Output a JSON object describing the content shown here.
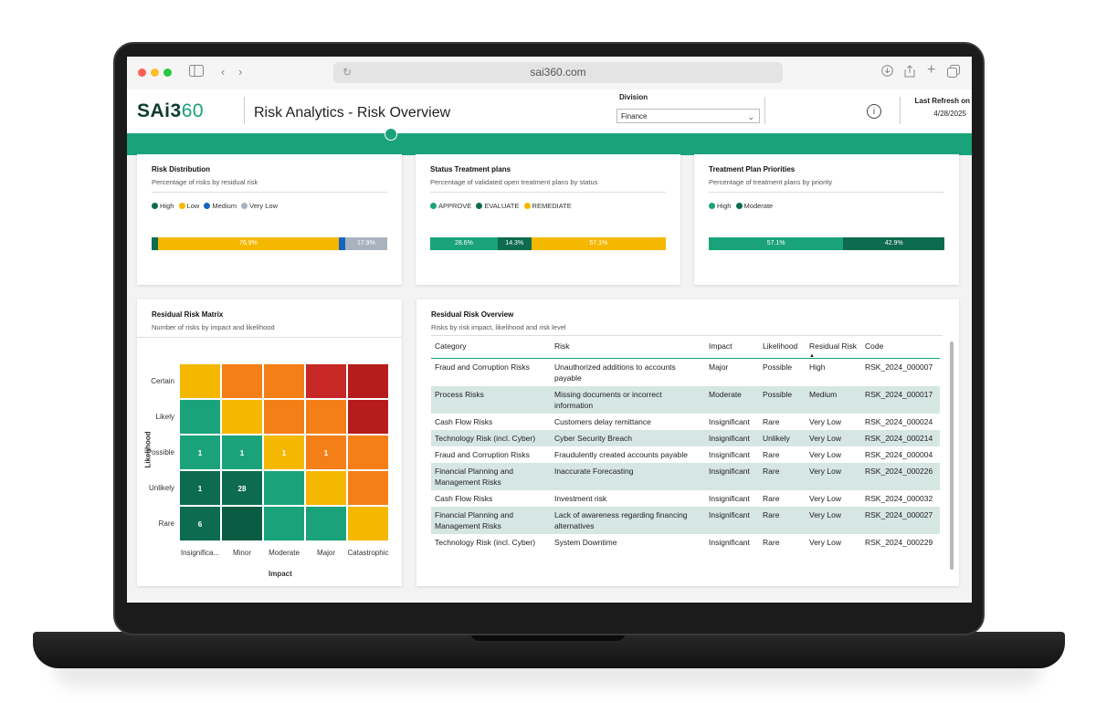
{
  "browser": {
    "url": "sai360.com"
  },
  "header": {
    "logo_main": "SAi3",
    "logo_num": "60",
    "title": "Risk Analytics - Risk Overview",
    "division_label": "Division",
    "division_value": "Finance",
    "refresh_label": "Last Refresh on",
    "refresh_date": "4/28/2025"
  },
  "colors": {
    "brand_green": "#1aa37a",
    "dark_green": "#0d6b4f",
    "amber": "#f5b800",
    "blue": "#1565c0",
    "gray": "#a9b3bf"
  },
  "risk_distribution": {
    "title": "Risk Distribution",
    "subtitle": "Percentage of risks by residual risk",
    "legend": [
      "High",
      "Low",
      "Medium",
      "Very Low"
    ],
    "bar": [
      {
        "name": "High",
        "value": 2.6,
        "label": "",
        "color": "#0d6b4f"
      },
      {
        "name": "Low",
        "value": 76.9,
        "label": "76.9%",
        "color": "#f5b800"
      },
      {
        "name": "Medium",
        "value": 2.6,
        "label": "",
        "color": "#1565c0"
      },
      {
        "name": "Very Low",
        "value": 17.9,
        "label": "17.9%",
        "color": "#a9b3bf"
      }
    ]
  },
  "status_treatment": {
    "title": "Status Treatment plans",
    "subtitle": "Percentage of validated open treatment plans by status",
    "legend": [
      "APPROVE",
      "EVALUATE",
      "REMEDIATE"
    ],
    "bar": [
      {
        "name": "APPROVE",
        "value": 28.6,
        "label": "28.6%",
        "color": "#1aa37a"
      },
      {
        "name": "EVALUATE",
        "value": 14.3,
        "label": "14.3%",
        "color": "#0d6b4f"
      },
      {
        "name": "REMEDIATE",
        "value": 57.1,
        "label": "57.1%",
        "color": "#f5b800"
      }
    ]
  },
  "treatment_priorities": {
    "title": "Treatment Plan Priorities",
    "subtitle": "Percentage of treatment plans by priority",
    "legend": [
      "High",
      "Moderate"
    ],
    "bar": [
      {
        "name": "High",
        "value": 57.1,
        "label": "57.1%",
        "color": "#1aa37a"
      },
      {
        "name": "Moderate",
        "value": 42.9,
        "label": "42.9%",
        "color": "#0d6b4f"
      }
    ]
  },
  "matrix": {
    "title": "Residual Risk Matrix",
    "subtitle": "Number of risks by impact and likelihood",
    "y_title": "Likelihood",
    "x_title": "Impact",
    "y_labels": [
      "Certain",
      "Likely",
      "Possible",
      "Unlikely",
      "Rare"
    ],
    "x_labels": [
      "Insignifica...",
      "Minor",
      "Moderate",
      "Major",
      "Catastrophic"
    ],
    "cells": [
      [
        {
          "c": "#f5b800",
          "v": ""
        },
        {
          "c": "#f57f17",
          "v": ""
        },
        {
          "c": "#f57f17",
          "v": ""
        },
        {
          "c": "#c62828",
          "v": ""
        },
        {
          "c": "#b71c1c",
          "v": ""
        }
      ],
      [
        {
          "c": "#1aa37a",
          "v": ""
        },
        {
          "c": "#f5b800",
          "v": ""
        },
        {
          "c": "#f57f17",
          "v": ""
        },
        {
          "c": "#f57f17",
          "v": ""
        },
        {
          "c": "#b71c1c",
          "v": ""
        }
      ],
      [
        {
          "c": "#1aa37a",
          "v": "1"
        },
        {
          "c": "#1aa37a",
          "v": "1"
        },
        {
          "c": "#f5b800",
          "v": "1"
        },
        {
          "c": "#f57f17",
          "v": "1"
        },
        {
          "c": "#f57f17",
          "v": ""
        }
      ],
      [
        {
          "c": "#0d6b4f",
          "v": "1"
        },
        {
          "c": "#0d6b4f",
          "v": "28"
        },
        {
          "c": "#1aa37a",
          "v": ""
        },
        {
          "c": "#f5b800",
          "v": ""
        },
        {
          "c": "#f57f17",
          "v": ""
        }
      ],
      [
        {
          "c": "#0d6b4f",
          "v": "6"
        },
        {
          "c": "#0a5c43",
          "v": ""
        },
        {
          "c": "#1aa37a",
          "v": ""
        },
        {
          "c": "#1aa37a",
          "v": ""
        },
        {
          "c": "#f5b800",
          "v": ""
        }
      ]
    ]
  },
  "overview": {
    "title": "Residual Risk Overview",
    "subtitle": "Risks by risk impact, likelihood and risk level",
    "columns": [
      "Category",
      "Risk",
      "Impact",
      "Likelihood",
      "Residual Risk",
      "Code"
    ],
    "rows": [
      [
        "Fraud and Corruption Risks",
        "Unauthorized additions to accounts payable",
        "Major",
        "Possible",
        "High",
        "RSK_2024_000007"
      ],
      [
        "Process Risks",
        "Missing documents or incorrect information",
        "Moderate",
        "Possible",
        "Medium",
        "RSK_2024_000017"
      ],
      [
        "Cash Flow Risks",
        "Customers delay remittance",
        "Insignificant",
        "Rare",
        "Very Low",
        "RSK_2024_000024"
      ],
      [
        "Technology Risk (incl. Cyber)",
        "Cyber Security Breach",
        "Insignificant",
        "Unlikely",
        "Very Low",
        "RSK_2024_000214"
      ],
      [
        "Fraud and Corruption Risks",
        "Fraudulently created accounts payable",
        "Insignificant",
        "Rare",
        "Very Low",
        "RSK_2024_000004"
      ],
      [
        "Financial Planning and Management Risks",
        "Inaccurate Forecasting",
        "Insignificant",
        "Rare",
        "Very Low",
        "RSK_2024_000226"
      ],
      [
        "Cash Flow Risks",
        "Investment risk",
        "Insignificant",
        "Rare",
        "Very Low",
        "RSK_2024_000032"
      ],
      [
        "Financial Planning and Management Risks",
        "Lack of awareness regarding financing alternatives",
        "Insignificant",
        "Rare",
        "Very Low",
        "RSK_2024_000027"
      ],
      [
        "Technology Risk (incl. Cyber)",
        "System Downtime",
        "Insignificant",
        "Rare",
        "Very Low",
        "RSK_2024_000229"
      ]
    ]
  }
}
